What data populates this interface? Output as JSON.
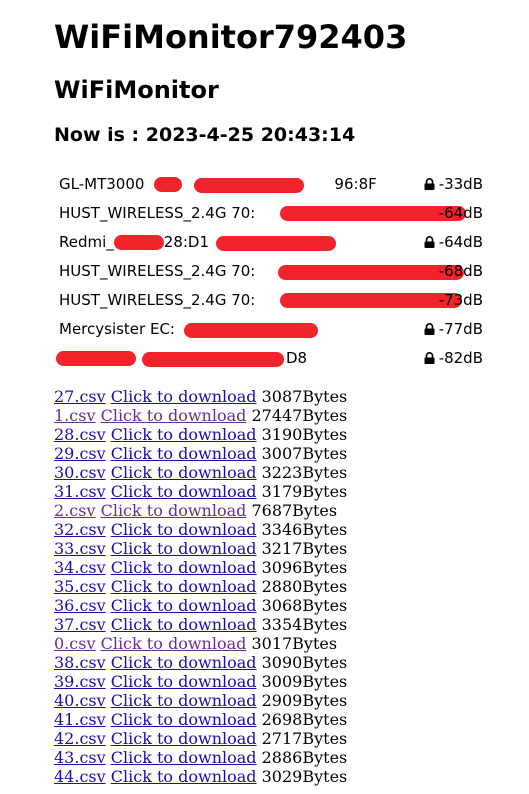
{
  "page": {
    "title": "WiFiMonitor792403",
    "subtitle": "WiFiMonitor",
    "now_label": "Now is : 2023-4-25 20:43:14"
  },
  "wifi": [
    {
      "name": "GL-MT3000",
      "tail": "96:8F",
      "rssi": "-33dB",
      "locked": true
    },
    {
      "name": "HUST_WIRELESS_2.4G 70:",
      "tail": "",
      "rssi": "-64dB",
      "locked": false
    },
    {
      "name": "Redmi_",
      "tail": "28:D1",
      "rssi": "-64dB",
      "locked": true
    },
    {
      "name": "HUST_WIRELESS_2.4G 70:",
      "tail": "",
      "rssi": "-68dB",
      "locked": false
    },
    {
      "name": "HUST_WIRELESS_2.4G 70:",
      "tail": "",
      "rssi": "-73dB",
      "locked": false
    },
    {
      "name": "Mercysister EC:",
      "tail": "",
      "rssi": "-77dB",
      "locked": true
    },
    {
      "name": "",
      "tail": "D8",
      "rssi": "-82dB",
      "locked": true
    }
  ],
  "files": [
    {
      "name": "27.csv",
      "link": "Click to download",
      "size": "3087Bytes",
      "visited": false
    },
    {
      "name": "1.csv",
      "link": "Click to download",
      "size": "27447Bytes",
      "visited": true
    },
    {
      "name": "28.csv",
      "link": "Click to download",
      "size": "3190Bytes",
      "visited": false
    },
    {
      "name": "29.csv",
      "link": "Click to download",
      "size": "3007Bytes",
      "visited": false
    },
    {
      "name": "30.csv",
      "link": "Click to download",
      "size": "3223Bytes",
      "visited": false
    },
    {
      "name": "31.csv",
      "link": "Click to download",
      "size": "3179Bytes",
      "visited": false
    },
    {
      "name": "2.csv",
      "link": "Click to download",
      "size": "7687Bytes",
      "visited": true
    },
    {
      "name": "32.csv",
      "link": "Click to download",
      "size": "3346Bytes",
      "visited": false
    },
    {
      "name": "33.csv",
      "link": "Click to download",
      "size": "3217Bytes",
      "visited": false
    },
    {
      "name": "34.csv",
      "link": "Click to download",
      "size": "3096Bytes",
      "visited": false
    },
    {
      "name": "35.csv",
      "link": "Click to download",
      "size": "2880Bytes",
      "visited": false
    },
    {
      "name": "36.csv",
      "link": "Click to download",
      "size": "3068Bytes",
      "visited": false
    },
    {
      "name": "37.csv",
      "link": "Click to download",
      "size": "3354Bytes",
      "visited": false
    },
    {
      "name": "0.csv",
      "link": "Click to download",
      "size": "3017Bytes",
      "visited": true
    },
    {
      "name": "38.csv",
      "link": "Click to download",
      "size": "3090Bytes",
      "visited": false
    },
    {
      "name": "39.csv",
      "link": "Click to download",
      "size": "3009Bytes",
      "visited": false
    },
    {
      "name": "40.csv",
      "link": "Click to download",
      "size": "2909Bytes",
      "visited": false
    },
    {
      "name": "41.csv",
      "link": "Click to download",
      "size": "2698Bytes",
      "visited": false
    },
    {
      "name": "42.csv",
      "link": "Click to download",
      "size": "2717Bytes",
      "visited": false
    },
    {
      "name": "43.csv",
      "link": "Click to download",
      "size": "2886Bytes",
      "visited": false
    },
    {
      "name": "44.csv",
      "link": "Click to download",
      "size": "3029Bytes",
      "visited": false
    }
  ],
  "colors": {
    "link": "#1a0dab",
    "visited_link": "#6a2c91",
    "redaction": "#f2232a"
  }
}
